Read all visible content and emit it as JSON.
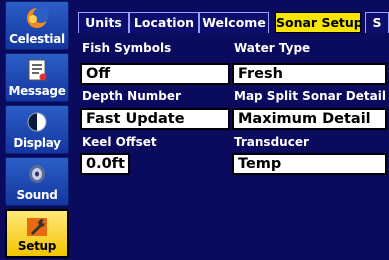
{
  "sidebar": {
    "items": [
      {
        "label": "Celestial",
        "icon": "moon-sun-icon"
      },
      {
        "label": "Message",
        "icon": "message-icon"
      },
      {
        "label": "Display",
        "icon": "display-icon"
      },
      {
        "label": "Sound",
        "icon": "speaker-icon"
      },
      {
        "label": "Setup",
        "icon": "wrench-icon",
        "active": true
      }
    ]
  },
  "tabs": [
    {
      "label": "Units"
    },
    {
      "label": "Location"
    },
    {
      "label": "Welcome"
    },
    {
      "label": "Sonar Setup",
      "active": true
    },
    {
      "label": "S"
    }
  ],
  "fields": {
    "fish_symbols": {
      "label": "Fish Symbols",
      "value": "Off"
    },
    "water_type": {
      "label": "Water Type",
      "value": "Fresh"
    },
    "depth_number": {
      "label": "Depth Number",
      "value": "Fast Update"
    },
    "map_split": {
      "label": "Map Split Sonar Detail",
      "value": "Maximum Detail"
    },
    "keel_offset": {
      "label": "Keel Offset",
      "value": "0.0ft"
    },
    "transducer": {
      "label": "Transducer",
      "value": "Temp"
    }
  }
}
